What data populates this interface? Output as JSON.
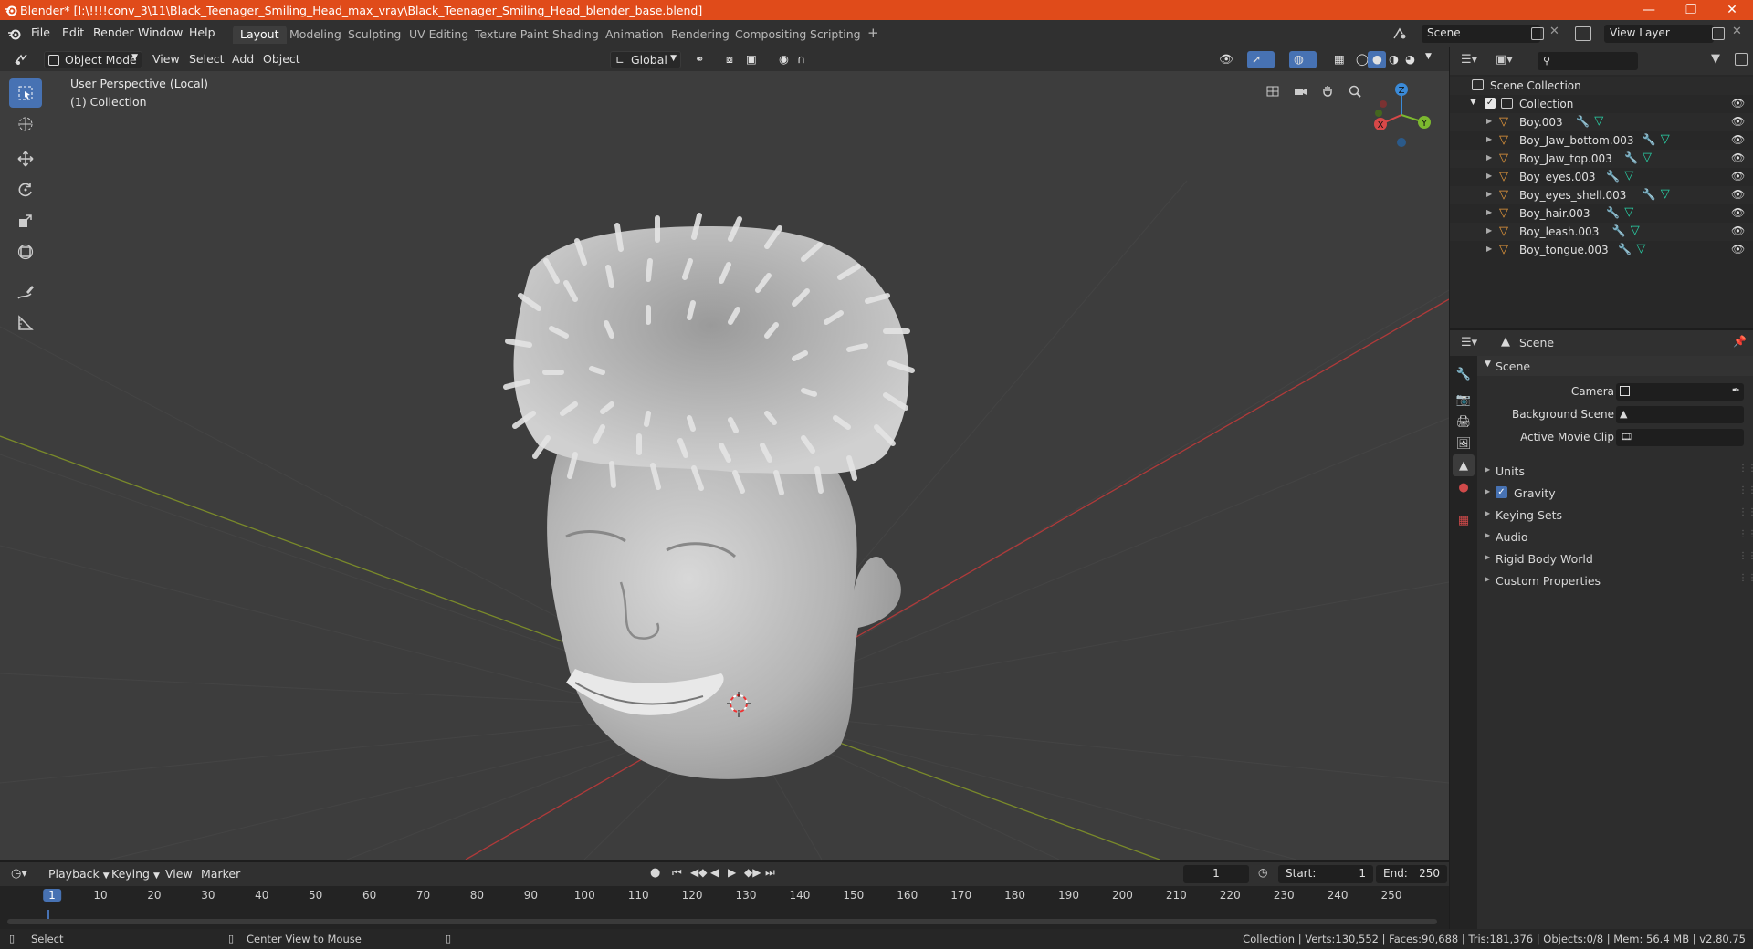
{
  "window": {
    "title": "Blender* [I:\\!!!!conv_3\\11\\Black_Teenager_Smiling_Head_max_vray\\Black_Teenager_Smiling_Head_blender_base.blend]",
    "accent": "#e04b1a"
  },
  "menubar": {
    "items": [
      "File",
      "Edit",
      "Render",
      "Window",
      "Help"
    ]
  },
  "workspaces": {
    "tabs": [
      "Layout",
      "Modeling",
      "Sculpting",
      "UV Editing",
      "Texture Paint",
      "Shading",
      "Animation",
      "Rendering",
      "Compositing",
      "Scripting"
    ],
    "active": "Layout",
    "add_label": "+"
  },
  "scene_field": "Scene",
  "view_layer_field": "View Layer",
  "viewport_header": {
    "mode": "Object Mode",
    "menus": [
      "View",
      "Select",
      "Add",
      "Object"
    ],
    "transform_orientation": "Global"
  },
  "viewport": {
    "perspective_label": "User Perspective (Local)",
    "collection_label": "(1) Collection",
    "gizmo_labels": {
      "x": "X",
      "y": "Y",
      "z": "Z"
    }
  },
  "outliner": {
    "root": "Scene Collection",
    "collection": "Collection",
    "objects": [
      "Boy.003",
      "Boy_Jaw_bottom.003",
      "Boy_Jaw_top.003",
      "Boy_eyes.003",
      "Boy_eyes_shell.003",
      "Boy_hair.003",
      "Boy_leash.003",
      "Boy_tongue.003"
    ]
  },
  "properties": {
    "context": "Scene",
    "panel_title": "Scene",
    "fields": [
      {
        "label": "Camera"
      },
      {
        "label": "Background Scene"
      },
      {
        "label": "Active Movie Clip"
      }
    ],
    "sections": [
      "Units",
      "Gravity",
      "Keying Sets",
      "Audio",
      "Rigid Body World",
      "Custom Properties"
    ],
    "gravity_checked": true
  },
  "timeline": {
    "menus": [
      "Playback",
      "Keying",
      "View",
      "Marker"
    ],
    "current_frame": "1",
    "start_label": "Start:",
    "start": "1",
    "end_label": "End:",
    "end": "250",
    "ruler": [
      "1",
      "10",
      "20",
      "30",
      "40",
      "50",
      "60",
      "70",
      "80",
      "90",
      "100",
      "110",
      "120",
      "130",
      "140",
      "150",
      "160",
      "170",
      "180",
      "190",
      "200",
      "210",
      "220",
      "230",
      "240",
      "250"
    ]
  },
  "statusbar": {
    "left_action": "Select",
    "middle_action": "Center View to Mouse",
    "stats": "Collection | Verts:130,552 | Faces:90,688 | Tris:181,376 | Objects:0/8 | Mem: 56.4 MB | v2.80.75"
  }
}
